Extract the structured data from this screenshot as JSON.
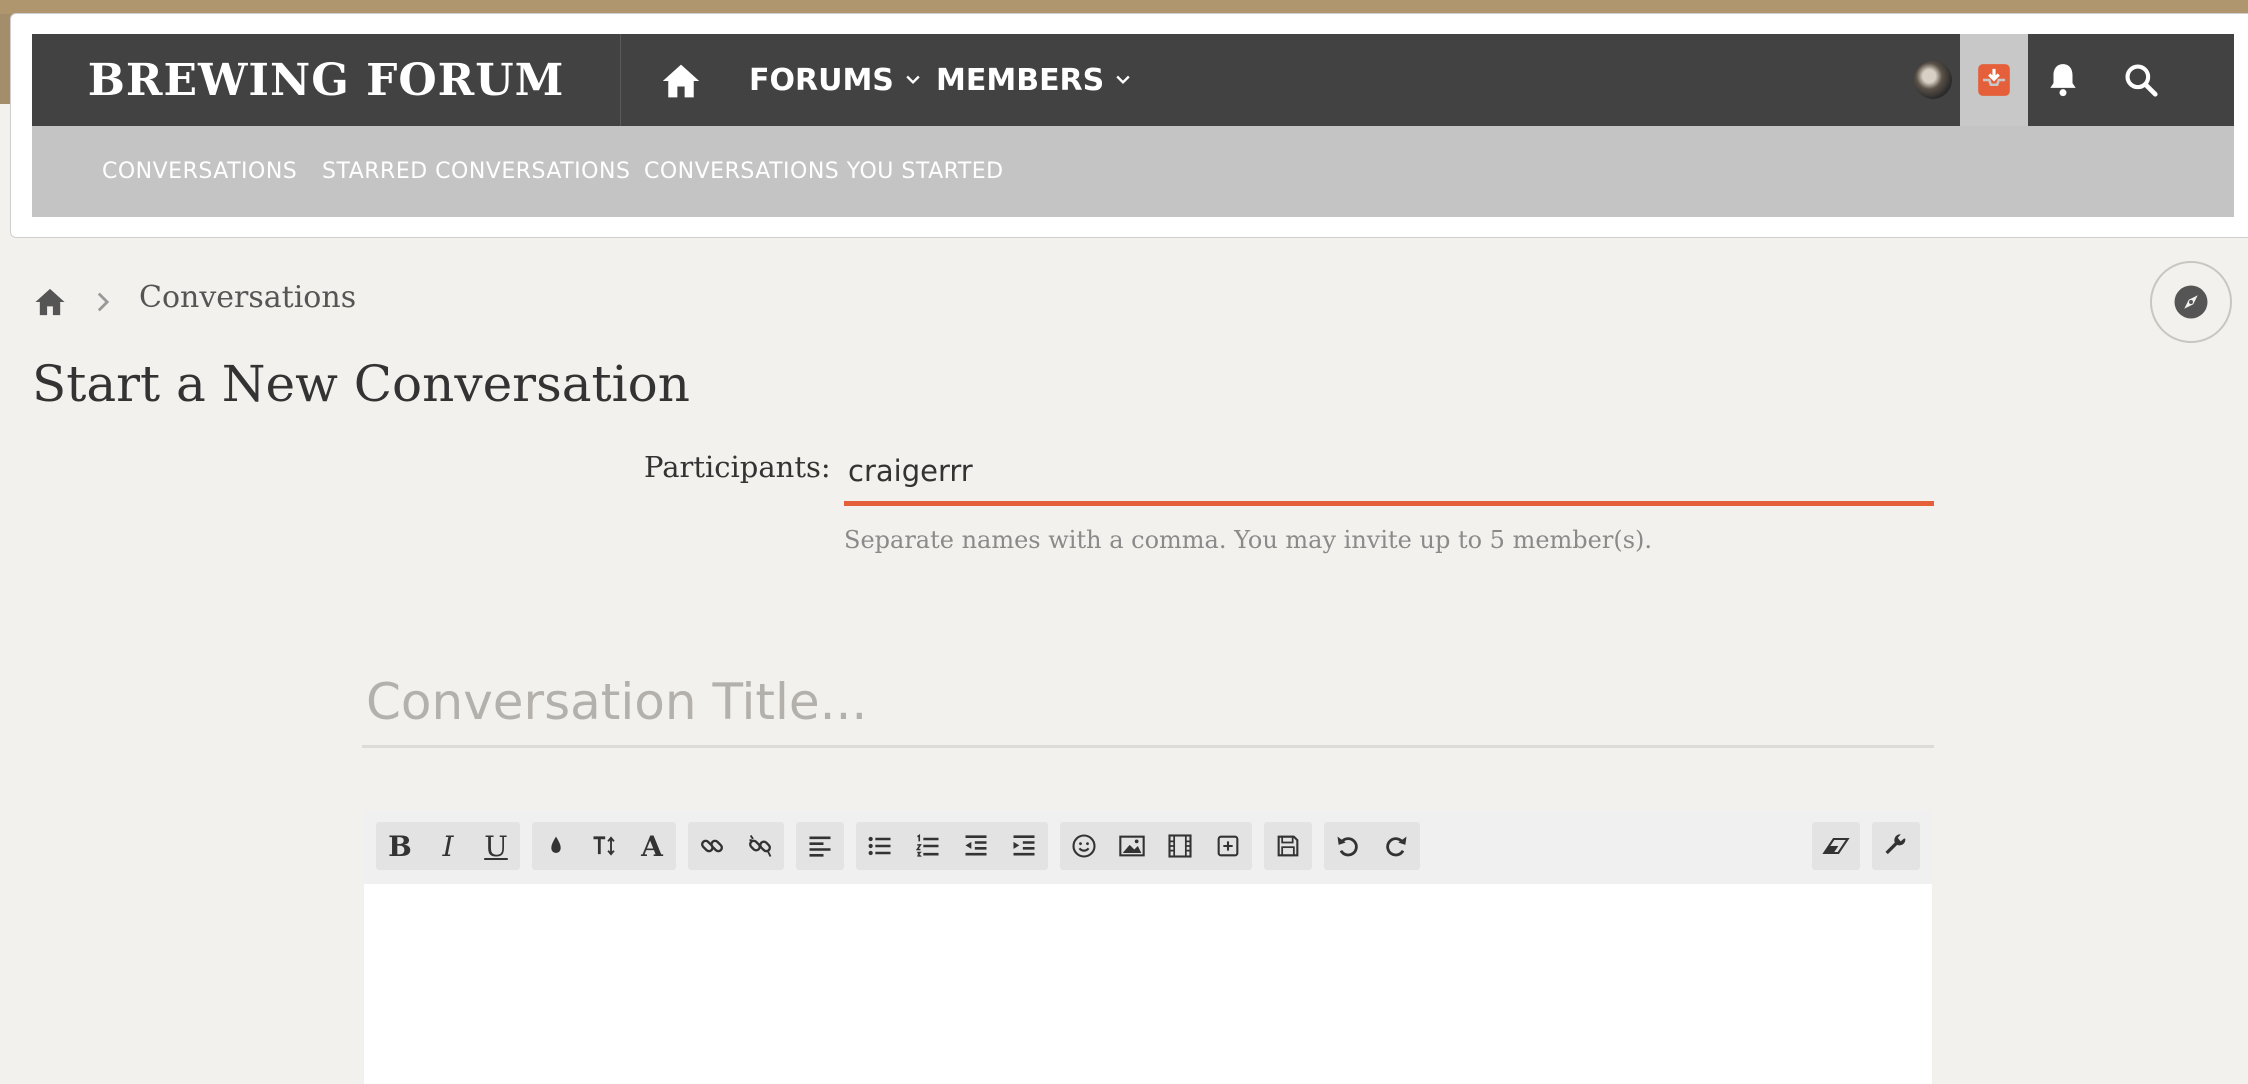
{
  "header": {
    "brand": "BREWING FORUM",
    "nav": [
      {
        "label": "FORUMS"
      },
      {
        "label": "MEMBERS"
      }
    ],
    "icons": [
      "home-icon",
      "user-avatar",
      "inbox-icon",
      "bell-icon",
      "search-icon"
    ]
  },
  "subnav": {
    "items": [
      {
        "label": "CONVERSATIONS"
      },
      {
        "label": "STARRED CONVERSATIONS"
      },
      {
        "label": "CONVERSATIONS YOU STARTED"
      }
    ]
  },
  "breadcrumb": {
    "current": "Conversations"
  },
  "page": {
    "title": "Start a New Conversation"
  },
  "form": {
    "participants_label": "Participants:",
    "participants_value": "craigerrr",
    "participants_hint": "Separate names with a comma. You may invite up to 5 member(s).",
    "title_placeholder": "Conversation Title..."
  },
  "colors": {
    "navbar": "#424242",
    "subnav": "#c4c4c4",
    "accent": "#e5603a",
    "background": "#f3f1ed"
  }
}
